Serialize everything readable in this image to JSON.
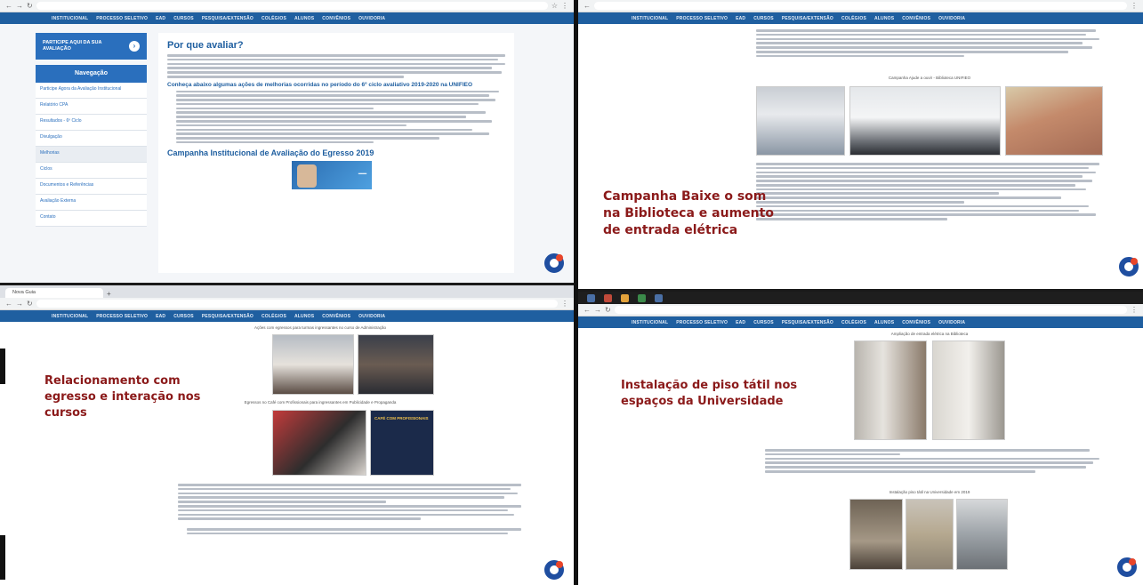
{
  "nav_items": [
    "INSTITUCIONAL",
    "PROCESSO SELETIVO",
    "EAD",
    "CURSOS",
    "PESQUISA/EXTENSÃO",
    "COLÉGIOS",
    "ALUNOS",
    "CONVÊNIOS",
    "OUVIDORIA"
  ],
  "q1": {
    "eval_button": "PARTICIPE AQUI DA SUA AVALIAÇÃO",
    "nav_heading": "Navegação",
    "sidebar_items": [
      "Participe Agora da Avaliação Institucional",
      "Relatório CPA",
      "Resultados - 6º Ciclo",
      "Divulgação",
      "Melhorias",
      "Ciclos",
      "Documentos e Referências",
      "Avaliação Externa",
      "Contato"
    ],
    "title": "Por que avaliar?",
    "subtitle": "Conheça abaixo algumas ações de melhorias ocorridas no período do 6º ciclo avaliativo 2019-2020 na UNIFIEO",
    "section_title": "Campanha Institucional de Avaliação do Egresso 2019"
  },
  "q2": {
    "photo_caption": "Campanha Ajude a ouvir - Biblioteca UNIFIEO",
    "overlay_caption": "Campanha Baixe o som na Biblioteca e aumento de entrada elétrica"
  },
  "q3": {
    "tab_label": "Nova Guia",
    "photo_caption_1": "Ações com egressos para turmas ingressantes no curso de Administração",
    "photo_caption_2": "Egressos no Café com Profissionais para ingressantes em Publicidade e Propaganda",
    "poster_text": "CAFÉ COM PROFISSIONAIS",
    "overlay_caption": "Relacionamento com egresso e interação nos cursos"
  },
  "q4": {
    "photo_caption_1": "Ampliação de entrada elétrica na Biblioteca",
    "photo_caption_2": "Instalação piso tátil na Universidade em 2019",
    "overlay_caption": "Instalação de piso tátil nos espaços da Universidade"
  }
}
